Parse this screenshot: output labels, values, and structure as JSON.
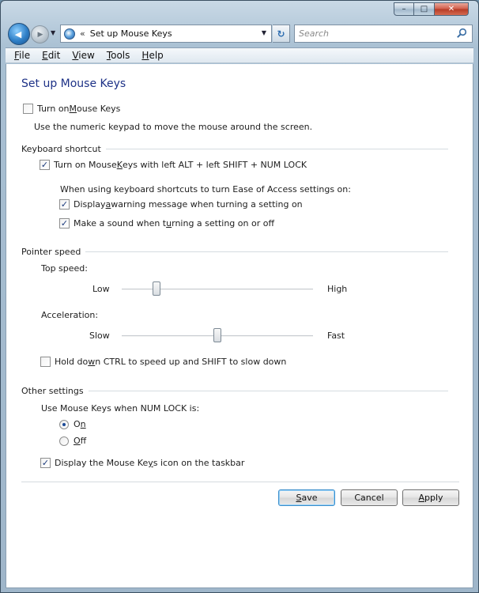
{
  "window": {
    "caption": {
      "minimize": "–",
      "maximize": "□",
      "close": "✕"
    }
  },
  "nav": {
    "back_glyph": "◀",
    "forward_glyph": "▶",
    "dropdown_glyph": "▼",
    "address_chevron": "«",
    "address_text": "Set up Mouse Keys",
    "refresh_glyph": "↻",
    "search_placeholder": "Search"
  },
  "menubar": {
    "items": [
      {
        "label": "File",
        "accel": "F",
        "rest": "ile"
      },
      {
        "label": "Edit",
        "accel": "E",
        "rest": "dit"
      },
      {
        "label": "View",
        "accel": "V",
        "rest": "iew"
      },
      {
        "label": "Tools",
        "accel": "T",
        "rest": "ools"
      },
      {
        "label": "Help",
        "accel": "H",
        "rest": "elp"
      }
    ]
  },
  "page": {
    "title": "Set up Mouse Keys",
    "turn_on": {
      "label_pre": "Turn on ",
      "accel": "M",
      "label_post": "ouse Keys",
      "checked": false
    },
    "turn_on_desc": "Use the numeric keypad to move the mouse around the screen.",
    "keyboard_shortcut": {
      "heading": "Keyboard shortcut",
      "shortcut": {
        "label_pre": "Turn on Mouse ",
        "accel": "K",
        "label_post": "eys with left ALT + left SHIFT + NUM LOCK",
        "checked": true
      },
      "note": "When using keyboard shortcuts to turn Ease of Access settings on:",
      "warning": {
        "label_pre": "Display ",
        "accel": "a",
        "label_post": " warning message when turning a setting on",
        "checked": true
      },
      "sound": {
        "label_pre": "Make a sound when t",
        "accel": "u",
        "label_post": "rning a setting on or off",
        "checked": true
      }
    },
    "pointer_speed": {
      "heading": "Pointer speed",
      "top_speed": {
        "label": "Top speed:",
        "low": "Low",
        "high": "High",
        "value": 0.18
      },
      "acceleration": {
        "label": "Acceleration:",
        "low": "Slow",
        "high": "Fast",
        "value": 0.5
      },
      "hold_ctrl": {
        "label": "Hold down CTRL to speed up and SHIFT to slow down",
        "accel_text": "Hold do",
        "accel": "w",
        "rest": "n CTRL to speed up and SHIFT to slow down",
        "checked": false
      }
    },
    "other": {
      "heading": "Other settings",
      "numlock_label": "Use Mouse Keys when NUM LOCK is:",
      "on": {
        "label_pre": "O",
        "accel": "n",
        "label_post": "",
        "selected": true
      },
      "off": {
        "label_pre": "",
        "accel": "O",
        "label_post": "ff",
        "selected": false
      },
      "taskbar_icon": {
        "label_pre": "Display the Mouse Ke",
        "accel": "y",
        "label_post": "s icon on the taskbar",
        "checked": true
      }
    },
    "buttons": {
      "save": {
        "accel": "S",
        "rest": "ave"
      },
      "cancel": "Cancel",
      "apply": {
        "accel": "A",
        "rest": "pply"
      }
    }
  },
  "colors": {
    "title_blue": "#1e3287",
    "chrome": "#a9c0d3"
  }
}
